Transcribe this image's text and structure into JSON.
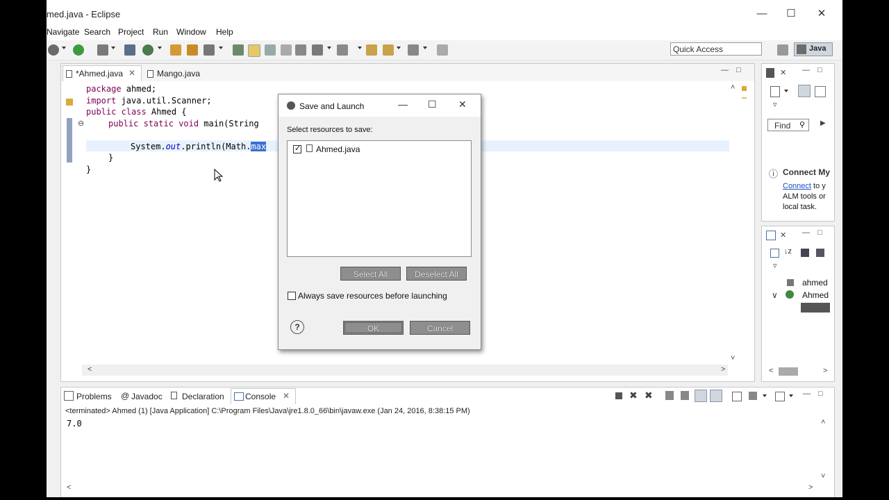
{
  "window": {
    "title": "med.java - Eclipse"
  },
  "menu": [
    "Navigate",
    "Search",
    "Project",
    "Run",
    "Window",
    "Help"
  ],
  "toolbar": {
    "quick_access": "Quick Access",
    "perspective": "Java"
  },
  "editor": {
    "tabs": [
      "*Ahmed.java",
      "Mango.java"
    ],
    "lines": {
      "l1_kw": "package",
      "l1_rest": " ahmed;",
      "l2_kw": "import",
      "l2_rest": " java.util.Scanner;",
      "l3_kw": "public class",
      "l3_rest": " Ahmed {",
      "l4_kw": "public static void",
      "l4_rest": " main(String ",
      "l6_a": "System.",
      "l6_field": "out",
      "l6_b": ".println(Math.",
      "l6_sel": "max",
      "l7": "}",
      "l8": "}"
    }
  },
  "right_top": {
    "find_label": "Find",
    "connect_title": "Connect My",
    "connect_link": "Connect",
    "connect_text1": " to y",
    "connect_text2": "ALM tools or",
    "connect_text3": "local task."
  },
  "outline": {
    "item1": "ahmed",
    "item2": "Ahmed"
  },
  "bottom": {
    "tabs": [
      "Problems",
      "Javadoc",
      "Declaration",
      "Console"
    ],
    "status": "<terminated> Ahmed (1) [Java Application] C:\\Program Files\\Java\\jre1.8.0_66\\bin\\javaw.exe (Jan 24, 2016, 8:38:15 PM)",
    "output": "7.0"
  },
  "dialog": {
    "title": "Save and Launch",
    "prompt": "Select resources to save:",
    "item": "Ahmed.java",
    "select_all": "Select All",
    "deselect_all": "Deselect All",
    "always_save": "Always save resources before launching",
    "ok": "OK",
    "cancel": "Cancel"
  }
}
